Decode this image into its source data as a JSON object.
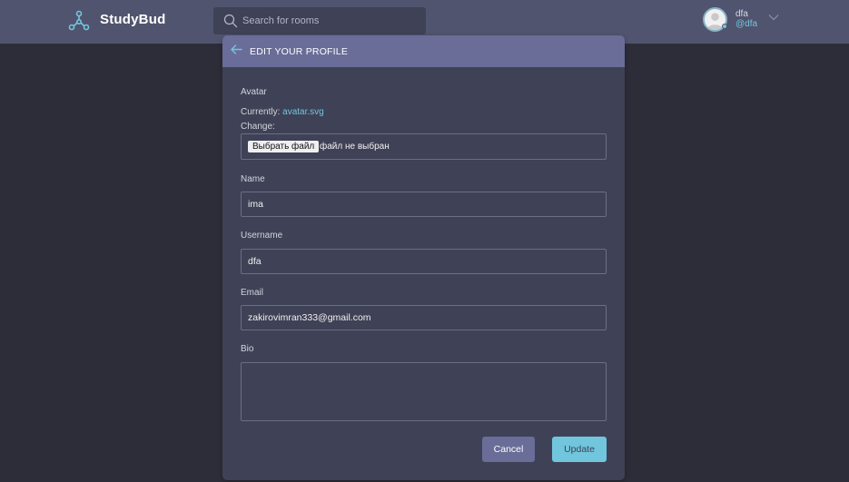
{
  "brand": {
    "name": "StudyBud"
  },
  "search": {
    "placeholder": "Search for rooms"
  },
  "user": {
    "name": "dfa",
    "handle": "@dfa"
  },
  "modal": {
    "title": "EDIT YOUR PROFILE",
    "avatar": {
      "label": "Avatar",
      "currently_prefix": "Currently:",
      "current_file": "avatar.svg",
      "change_label": "Change:",
      "choose_button": "Выбрать файл",
      "no_file_text": "файл не выбран"
    },
    "name": {
      "label": "Name",
      "value": "ima"
    },
    "username": {
      "label": "Username",
      "value": "dfa"
    },
    "email": {
      "label": "Email",
      "value": "zakirovimran333@gmail.com"
    },
    "bio": {
      "label": "Bio",
      "value": ""
    },
    "cancel_label": "Cancel",
    "update_label": "Update"
  },
  "colors": {
    "background": "#2d2d39",
    "topbar": "#51546e",
    "modal": "#3f4156",
    "modal_header": "#696d97",
    "accent": "#71c6dd"
  },
  "icons": [
    "studybud-logo-icon",
    "search-icon",
    "user-avatar",
    "chevron-down-icon",
    "arrow-left-icon"
  ]
}
